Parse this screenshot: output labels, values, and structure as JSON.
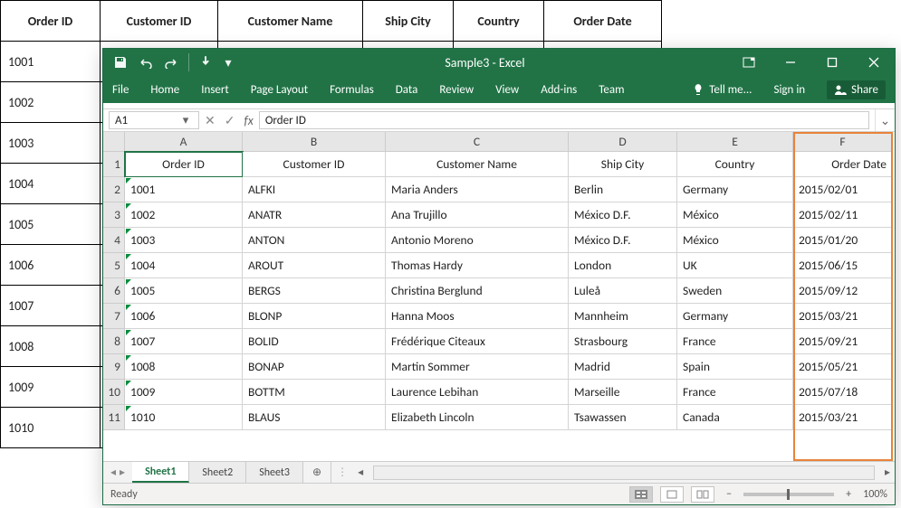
{
  "background_table": {
    "headers": [
      "Order ID",
      "Customer ID",
      "Customer Name",
      "Ship City",
      "Country",
      "Order Date"
    ],
    "rows": [
      "1001",
      "1002",
      "1003",
      "1004",
      "1005",
      "1006",
      "1007",
      "1008",
      "1009",
      "1010"
    ]
  },
  "excel": {
    "title": "Sample3 - Excel",
    "ribbon_tabs": [
      "File",
      "Home",
      "Insert",
      "Page Layout",
      "Formulas",
      "Data",
      "Review",
      "View",
      "Add-ins",
      "Team"
    ],
    "tell_me": "Tell me...",
    "sign_in": "Sign in",
    "share": "Share",
    "name_box": "A1",
    "formula_value": "Order ID",
    "col_letters": [
      "A",
      "B",
      "C",
      "D",
      "E",
      "F"
    ],
    "row_numbers": [
      "1",
      "2",
      "3",
      "4",
      "5",
      "6",
      "7",
      "8",
      "9",
      "10",
      "11"
    ],
    "header_row": [
      "Order ID",
      "Customer ID",
      "Customer Name",
      "Ship City",
      "Country",
      "Order Date"
    ],
    "data_rows": [
      [
        "1001",
        "ALFKI",
        "Maria Anders",
        "Berlin",
        "Germany",
        "2015/02/01"
      ],
      [
        "1002",
        "ANATR",
        "Ana Trujillo",
        "México D.F.",
        "México",
        "2015/02/11"
      ],
      [
        "1003",
        "ANTON",
        "Antonio Moreno",
        "México D.F.",
        "México",
        "2015/01/20"
      ],
      [
        "1004",
        "AROUT",
        "Thomas Hardy",
        "London",
        "UK",
        "2015/06/15"
      ],
      [
        "1005",
        "BERGS",
        "Christina Berglund",
        "Luleå",
        "Sweden",
        "2015/09/12"
      ],
      [
        "1006",
        "BLONP",
        "Hanna Moos",
        "Mannheim",
        "Germany",
        "2015/03/21"
      ],
      [
        "1007",
        "BOLID",
        "Frédérique Citeaux",
        "Strasbourg",
        "France",
        "2015/09/21"
      ],
      [
        "1008",
        "BONAP",
        "Martin Sommer",
        "Madrid",
        "Spain",
        "2015/05/21"
      ],
      [
        "1009",
        "BOTTM",
        "Laurence Lebihan",
        "Marseille",
        "France",
        "2015/07/18"
      ],
      [
        "1010",
        "BLAUS",
        "Elizabeth Lincoln",
        "Tsawassen",
        "Canada",
        "2015/03/21"
      ]
    ],
    "sheet_tabs": [
      "Sheet1",
      "Sheet2",
      "Sheet3"
    ],
    "status_ready": "Ready",
    "zoom_level": "100%"
  }
}
